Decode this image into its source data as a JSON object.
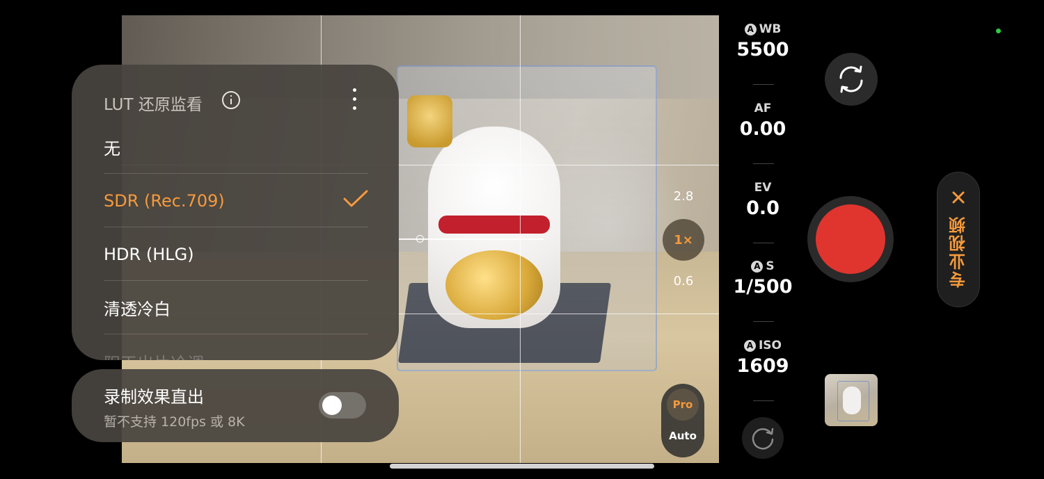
{
  "viewfinder": {
    "zoom_levels": [
      "2.8",
      "1×",
      "0.6"
    ],
    "modes": {
      "pro": "Pro",
      "auto": "Auto"
    }
  },
  "lut_panel": {
    "title": "LUT 还原监看",
    "items": [
      {
        "label": "无",
        "selected": false
      },
      {
        "label": "SDR (Rec.709)",
        "selected": true
      },
      {
        "label": "HDR (HLG)",
        "selected": false
      },
      {
        "label": "清透冷白",
        "selected": false
      },
      {
        "label": "阳天出片冷调",
        "selected": false
      }
    ]
  },
  "record_effect": {
    "title": "录制效果直出",
    "subtitle": "暂不支持 120fps 或 8K",
    "toggle_on": false
  },
  "settings": {
    "wb": {
      "label": "WB",
      "auto": "A",
      "value": "5500"
    },
    "af": {
      "label": "AF",
      "value": "0.00"
    },
    "ev": {
      "label": "EV",
      "value": "0.0"
    },
    "s": {
      "label": "S",
      "auto": "A",
      "value": "1/500"
    },
    "iso": {
      "label": "ISO",
      "auto": "A",
      "value": "1609"
    }
  },
  "controls": {
    "mode_name": "专业视频",
    "shutter_color": "#e0352f",
    "accent": "#f59a3c"
  },
  "icons": [
    "info-icon",
    "more-icon",
    "check-icon",
    "switch-camera-icon",
    "refresh-icon",
    "close-icon"
  ]
}
